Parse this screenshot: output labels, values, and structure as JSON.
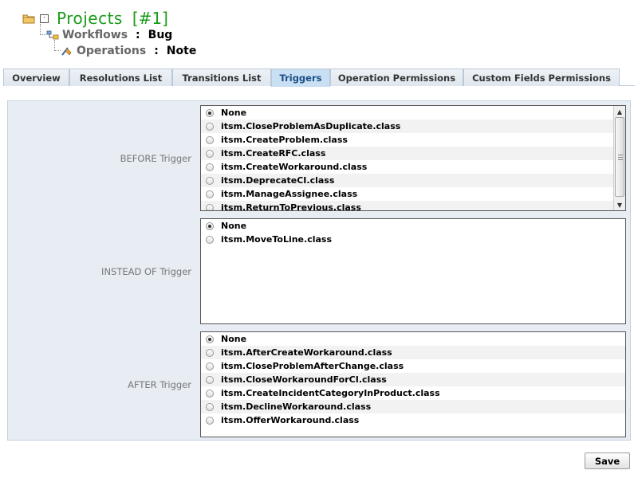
{
  "breadcrumb": {
    "project_label": "Projects",
    "project_id": "[#1]",
    "workflows_label": "Workflows",
    "workflows_value": "Bug",
    "operations_label": "Operations",
    "operations_value": "Note",
    "separator": ":"
  },
  "tabs": [
    {
      "label": "Overview",
      "active": false
    },
    {
      "label": "Resolutions List",
      "active": false
    },
    {
      "label": "Transitions List",
      "active": false
    },
    {
      "label": "Triggers",
      "active": true
    },
    {
      "label": "Operation Permissions",
      "active": false
    },
    {
      "label": "Custom Fields Permissions",
      "active": false
    }
  ],
  "triggers": {
    "before": {
      "label": "BEFORE Trigger",
      "selected": "None",
      "options": [
        "None",
        "itsm.CloseProblemAsDuplicate.class",
        "itsm.CreateProblem.class",
        "itsm.CreateRFC.class",
        "itsm.CreateWorkaround.class",
        "itsm.DeprecateCI.class",
        "itsm.ManageAssignee.class",
        "itsm.ReturnToPrevious.class"
      ]
    },
    "instead_of": {
      "label": "INSTEAD OF Trigger",
      "selected": "None",
      "options": [
        "None",
        "itsm.MoveToLine.class"
      ]
    },
    "after": {
      "label": "AFTER Trigger",
      "selected": "None",
      "options": [
        "None",
        "itsm.AfterCreateWorkaround.class",
        "itsm.CloseProblemAfterChange.class",
        "itsm.CloseWorkaroundForCI.class",
        "itsm.CreateIncidentCategoryInProduct.class",
        "itsm.DeclineWorkaround.class",
        "itsm.OfferWorkaround.class"
      ]
    }
  },
  "actions": {
    "save_label": "Save"
  },
  "icons": {
    "project": "folder-icon",
    "expand": "expand-icon",
    "workflow": "workflow-icon",
    "operation": "operation-icon"
  },
  "colors": {
    "title_green": "#1a9c1a",
    "active_tab_bg": "#c9dff3",
    "active_tab_text": "#1b4f86",
    "panel_bg": "#e7edf3"
  }
}
